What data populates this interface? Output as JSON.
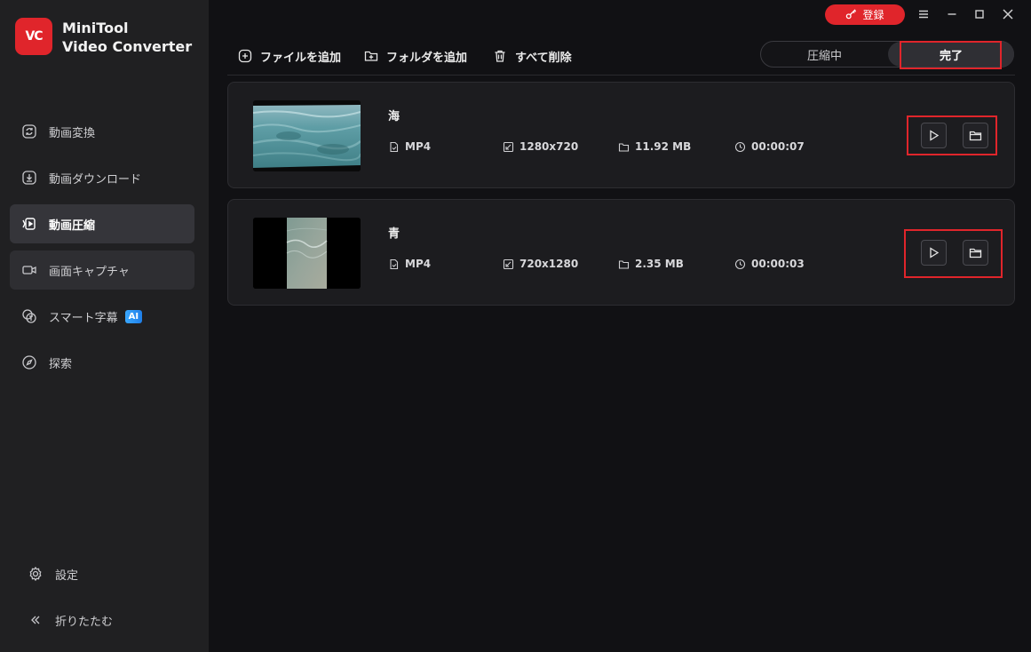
{
  "app": {
    "logo_text": "VC",
    "brand_line1": "MiniTool",
    "brand_line2": "Video Converter"
  },
  "titlebar": {
    "register_label": "登録"
  },
  "sidebar": {
    "items": [
      {
        "label": "動画変換",
        "icon": "convert-icon"
      },
      {
        "label": "動画ダウンロード",
        "icon": "download-icon"
      },
      {
        "label": "動画圧縮",
        "icon": "compress-icon",
        "active": true
      },
      {
        "label": "画面キャプチャ",
        "icon": "camera-icon"
      },
      {
        "label": "スマート字幕",
        "icon": "subtitle-icon",
        "badge": "AI"
      },
      {
        "label": "探索",
        "icon": "compass-icon"
      }
    ],
    "settings_label": "設定",
    "collapse_label": "折りたたむ"
  },
  "toolbar": {
    "add_file_label": "ファイルを追加",
    "add_folder_label": "フォルダを追加",
    "delete_all_label": "すべて削除"
  },
  "tabs": {
    "compressing_label": "圧縮中",
    "done_label": "完了",
    "selected": "完了"
  },
  "files": [
    {
      "name": "海",
      "format": "MP4",
      "resolution": "1280x720",
      "size": "11.92 MB",
      "duration": "00:00:07"
    },
    {
      "name": "青",
      "format": "MP4",
      "resolution": "720x1280",
      "size": "2.35 MB",
      "duration": "00:00:03"
    }
  ],
  "colors": {
    "accent": "#e0252b",
    "sidebar_bg": "#202022",
    "main_bg": "#111114",
    "card_bg": "#1c1c1f",
    "ai_badge": "#2b93f5"
  }
}
